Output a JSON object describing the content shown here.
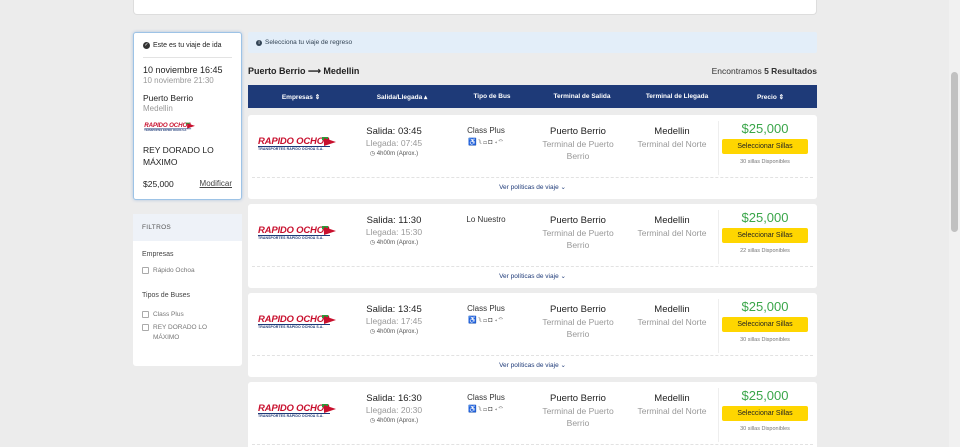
{
  "trip": {
    "header": "Este es tu viaje de ida",
    "date_depart": "10 noviembre 16:45",
    "date_arrive": "10 noviembre 21:30",
    "origin": "Puerto Berrio",
    "destination": "Medellin",
    "bus_type": "REY DORADO LO MÁXIMO",
    "price": "$25,000",
    "modify": "Modificar"
  },
  "filters": {
    "title": "FILTROS",
    "companies_label": "Empresas",
    "companies": [
      "Rápido Ochoa"
    ],
    "bus_types_label": "Tipos de Buses",
    "bus_types": [
      "Class Plus",
      "REY DORADO LO MÁXIMO"
    ]
  },
  "notice": "Selecciona tu viaje de regreso",
  "route": "Puerto Berrio ⟶ Medellin",
  "results": {
    "prefix": "Encontramos ",
    "count": "5 Resultados"
  },
  "columns": [
    "Empresas ⇕",
    "Salida/Llegada ▴",
    "Tipo de Bus",
    "Terminal de Salida",
    "Terminal de Llegada",
    "Precio ⇕"
  ],
  "company_logo": {
    "name": "RAPIDO OCHOA",
    "tagline": "TRANSPORTES RAPIDO OCHOA S.A."
  },
  "rows": [
    {
      "depart": "Salida: 03:45",
      "arrive": "Llegada: 07:45",
      "duration": "4h00m (Aprox.)",
      "bus_type": "Class Plus",
      "amenities": "♿⑊▭◘◂⌔",
      "origin_city": "Puerto Berrio",
      "origin_terminal": "Terminal de Puerto Berrio",
      "dest_city": "Medellin",
      "dest_terminal": "Terminal del Norte",
      "price": "$25,000",
      "button": "Seleccionar Sillas",
      "seats": "30 sillas Disponibles",
      "policy": "Ver políticas de viaje ⌄"
    },
    {
      "depart": "Salida: 11:30",
      "arrive": "Llegada: 15:30",
      "duration": "4h00m (Aprox.)",
      "bus_type": "Lo Nuestro",
      "amenities": "",
      "origin_city": "Puerto Berrio",
      "origin_terminal": "Terminal de Puerto Berrio",
      "dest_city": "Medellin",
      "dest_terminal": "Terminal del Norte",
      "price": "$25,000",
      "button": "Seleccionar Sillas",
      "seats": "22 sillas Disponibles",
      "policy": "Ver políticas de viaje ⌄"
    },
    {
      "depart": "Salida: 13:45",
      "arrive": "Llegada: 17:45",
      "duration": "4h00m (Aprox.)",
      "bus_type": "Class Plus",
      "amenities": "♿⑊▭◘◂⌔",
      "origin_city": "Puerto Berrio",
      "origin_terminal": "Terminal de Puerto Berrio",
      "dest_city": "Medellin",
      "dest_terminal": "Terminal del Norte",
      "price": "$25,000",
      "button": "Seleccionar Sillas",
      "seats": "30 sillas Disponibles",
      "policy": "Ver políticas de viaje ⌄"
    },
    {
      "depart": "Salida: 16:30",
      "arrive": "Llegada: 20:30",
      "duration": "4h00m (Aprox.)",
      "bus_type": "Class Plus",
      "amenities": "♿⑊▭◘◂⌔",
      "origin_city": "Puerto Berrio",
      "origin_terminal": "Terminal de Puerto Berrio",
      "dest_city": "Medellin",
      "dest_terminal": "Terminal del Norte",
      "price": "$25,000",
      "button": "Seleccionar Sillas",
      "seats": "30 sillas Disponibles",
      "policy": ""
    }
  ],
  "colors": {
    "header": "#1e3a78",
    "price": "#3aa64a",
    "button": "#ffd600",
    "brand": "#c8102e"
  }
}
